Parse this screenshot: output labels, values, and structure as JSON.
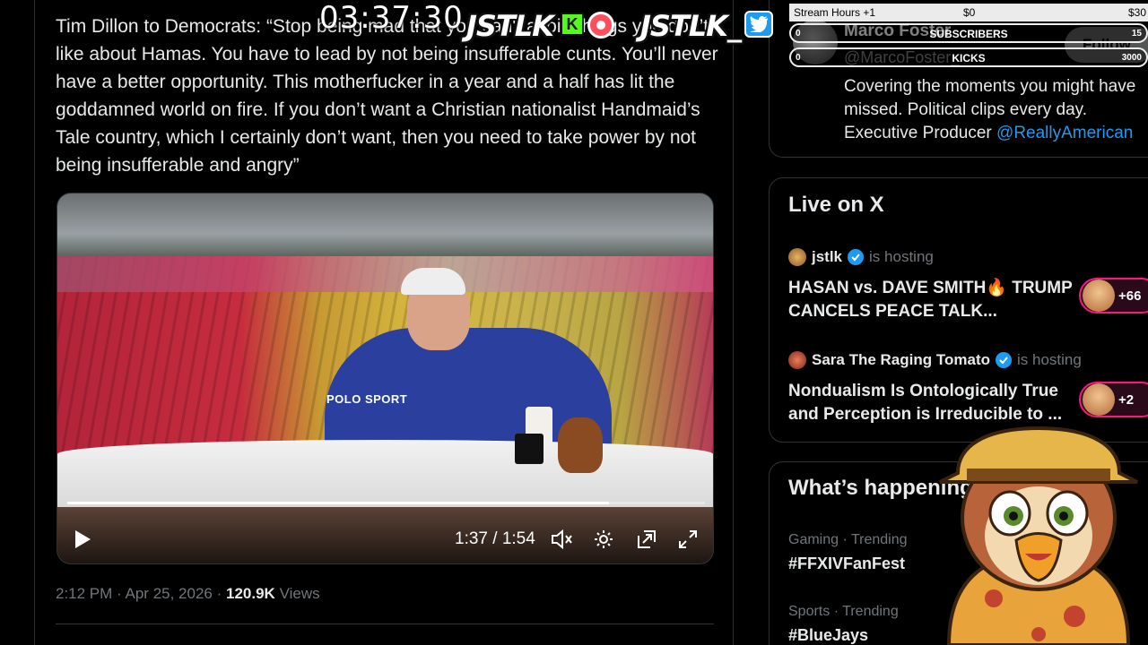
{
  "tweet": {
    "text": "Tim Dillon to Democrats: “Stop being mad that you can't avoid things you don’t like about Hamas. You have to lead by not being insufferable cunts. You’ll never have a better opportunity. This motherfucker in a year and a half has lit the goddamned world on fire. If you don’t want a Christian nationalist Handmaid’s Tale country, which I certainly don’t want, then you need to take power by not being insufferable and angry”",
    "time": "2:12 PM",
    "separator": "·",
    "date": "Apr 25, 2026",
    "views_count": "120.9K",
    "views_label": "Views"
  },
  "video": {
    "shirt_text": "POLO SPORT",
    "current_time": "1:37",
    "duration": "1:54",
    "time_display": "1:37 / 1:54",
    "progress_fraction": 0.85
  },
  "profile": {
    "name": "Marco Foster",
    "handle": "@MarcoFoster_",
    "follow_label": "Follow",
    "bio_line1": "Covering the moments you might have",
    "bio_line2": "missed. Political clips every day.",
    "bio_line3_prefix": "Executive Producer ",
    "bio_link": "@ReallyAmerican"
  },
  "live": {
    "title": "Live on X",
    "spaces": [
      {
        "host": "jstlk",
        "status": "is hosting",
        "title": "HASAN vs. DAVE SMITH🔥 TRUMP CANCELS PEACE TALK...",
        "listeners": "+66"
      },
      {
        "host": "Sara The Raging Tomato",
        "status": "is hosting",
        "title": "Nondualism Is Ontologically True and Perception is Irreducible to ...",
        "listeners": "+2"
      }
    ]
  },
  "trends": {
    "title": "What’s happening",
    "items": [
      {
        "meta": "Gaming · Trending",
        "name": "#FFXIVFanFest"
      },
      {
        "meta": "Sports · Trending",
        "name": "#BlueJays"
      }
    ]
  },
  "overlay": {
    "clock": "03:37:30",
    "brand_left": "JSTLK",
    "brand_right": "JSTLK_",
    "kick_letter": "K",
    "goals": {
      "header_label": "Stream Hours +1",
      "header_min": "$0",
      "header_max": "$30",
      "subs_label": "SUBSCRIBERS",
      "subs_min": "0",
      "subs_max": "15",
      "kicks_label": "KICKS",
      "kicks_min": "0",
      "kicks_max": "3000"
    }
  },
  "colors": {
    "background": "#000000",
    "accent": "#1d9bf0",
    "text_primary": "#e7e9ea",
    "text_secondary": "#71767b",
    "live_pill": "#f91880",
    "kick_green": "#53fc18"
  }
}
